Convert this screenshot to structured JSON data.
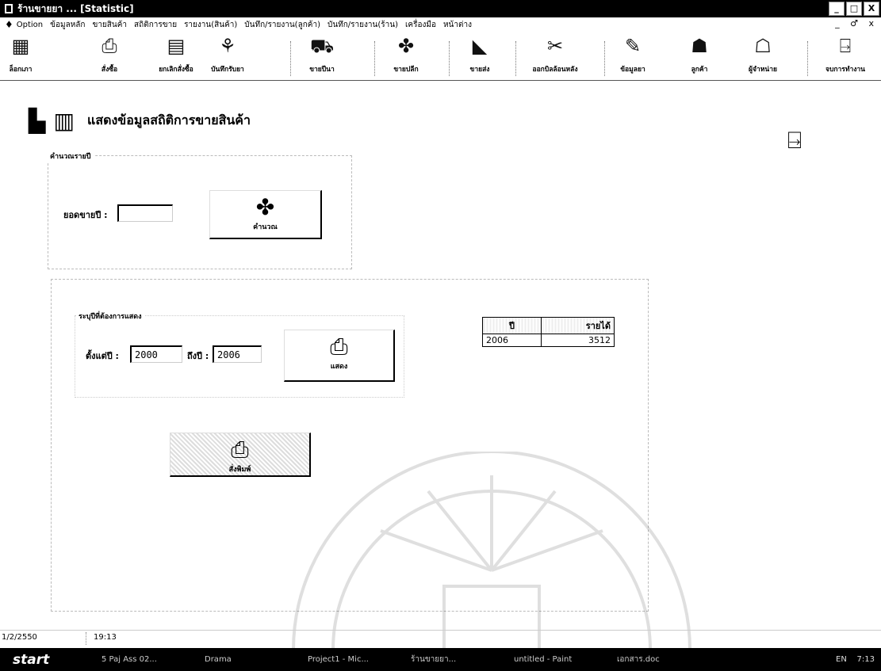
{
  "window": {
    "title": "ร้านขายยา ...  [Statistic]",
    "controls": [
      "_",
      "□",
      "X"
    ]
  },
  "menu": {
    "items": [
      "Option",
      "ข้อมูลหลัก",
      "ขายสินค้า",
      "สถิติการขาย",
      "รายงาน(สินค้า)",
      "บันทึก/รายงาน(ลูกค้า)",
      "บันทึก/รายงาน(ร้าน)",
      "เครื่องมือ",
      "หน้าต่าง"
    ],
    "mdi_controls": "_ ♂ x"
  },
  "toolbar": {
    "buttons": [
      {
        "label": "ล็อกเภา",
        "icon": "grid-icon"
      },
      {
        "label": "สั่งซื้อ",
        "icon": "printer-icon"
      },
      {
        "label": "ยกเลิกสั่งซื้อ",
        "icon": "document-icon"
      },
      {
        "label": "บันทึกรับยา",
        "icon": "receive-icon"
      },
      {
        "label": "ขายปีนา",
        "icon": "truck-icon"
      },
      {
        "label": "ขายปลีก",
        "icon": "pills-icon"
      },
      {
        "label": "ขายส่ง",
        "icon": "box-icon"
      },
      {
        "label": "ออกบิลล้อนหลัง",
        "icon": "bill-icon"
      },
      {
        "label": "ข้อมูลยา",
        "icon": "info-icon"
      },
      {
        "label": "ลูกค้า",
        "icon": "customer-icon"
      },
      {
        "label": "ผู้จำหน่าย",
        "icon": "supplier-icon"
      },
      {
        "label": "จบการทำงาน",
        "icon": "exit-icon"
      }
    ]
  },
  "page": {
    "title": "แสดงข้อมูลสถิติการขายสินค้า"
  },
  "calc_group": {
    "label": "คำนวณรายปี",
    "field_label": "ยอดขายปี :",
    "field_value": "",
    "button_label": "คำนวณ"
  },
  "range_group": {
    "label": "ระบุปีที่ต้องการแสดง",
    "from_label": "ตั้งแต่ปี :",
    "from_value": "2000",
    "to_label": "ถึงปี :",
    "to_value": "2006",
    "show_button_label": "แสดง"
  },
  "result_table": {
    "columns": [
      "ปี",
      "รายได้"
    ],
    "rows": [
      {
        "year": "2006",
        "income": "3512"
      }
    ]
  },
  "print_button_label": "สั่งพิมพ์",
  "statusbar": {
    "date": "1/2/2550",
    "time": "19:13"
  },
  "taskbar": {
    "start_label": "start",
    "tasks": [
      "5 Paj Ass 02...",
      "Drama",
      "Project1 - Mic...",
      "ร้านขายยา...",
      "untitled - Paint",
      "เอกสาร.doc"
    ],
    "tray_lang": "EN",
    "tray_time": "7:13"
  }
}
